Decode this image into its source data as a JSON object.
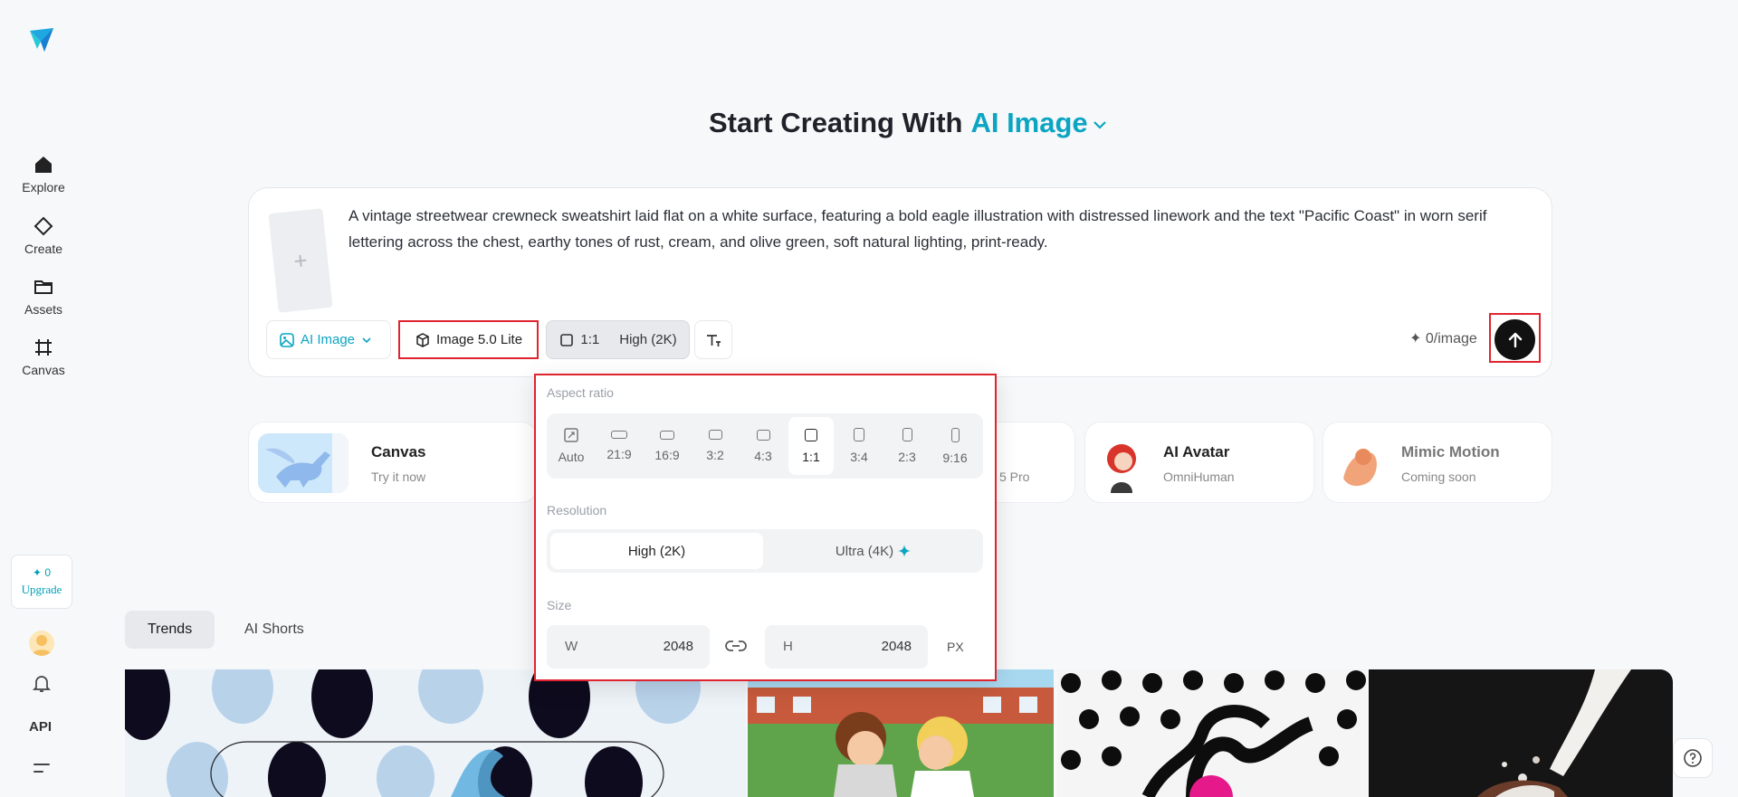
{
  "sidebar": {
    "items": [
      {
        "label": "Explore",
        "icon": "home-icon"
      },
      {
        "label": "Create",
        "icon": "diamond-icon"
      },
      {
        "label": "Assets",
        "icon": "folder-icon"
      },
      {
        "label": "Canvas",
        "icon": "canvas-icon"
      }
    ],
    "credits": "✦ 0",
    "upgrade": "Upgrade",
    "api": "API"
  },
  "heading": {
    "prefix": "Start Creating With",
    "accent": "AI Image"
  },
  "prompt": {
    "text": "A vintage streetwear crewneck sweatshirt laid flat on a white surface, featuring a bold eagle illustration with distressed linework and the text \"Pacific Coast\" in worn serif lettering across the chest, earthy tones of rust, cream, and olive green, soft natural lighting, print-ready.",
    "add_ref": "+"
  },
  "toolbar": {
    "mode": "AI Image",
    "model": "Image 5.0 Lite",
    "ratio": "1:1",
    "quality": "High (2K)",
    "cost": "✦ 0/image"
  },
  "features": [
    {
      "title": "Canvas",
      "subtitle": "Try it now"
    },
    {
      "title": "",
      "subtitle": "5 Pro"
    },
    {
      "title": "AI Avatar",
      "subtitle": "OmniHuman"
    },
    {
      "title": "Mimic Motion",
      "subtitle": "Coming soon"
    }
  ],
  "tabs": [
    "Trends",
    "AI Shorts"
  ],
  "popover": {
    "aspect_label": "Aspect ratio",
    "ratios": [
      "Auto",
      "21:9",
      "16:9",
      "3:2",
      "4:3",
      "1:1",
      "3:4",
      "2:3",
      "9:16"
    ],
    "selected_ratio": "1:1",
    "resolution_label": "Resolution",
    "resolutions": [
      "High (2K)",
      "Ultra (4K)"
    ],
    "size_label": "Size",
    "w_label": "W",
    "w_value": "2048",
    "h_label": "H",
    "h_value": "2048",
    "unit": "PX"
  },
  "colors": {
    "accent": "#0ba5c2",
    "highlight": "#e0242f"
  }
}
